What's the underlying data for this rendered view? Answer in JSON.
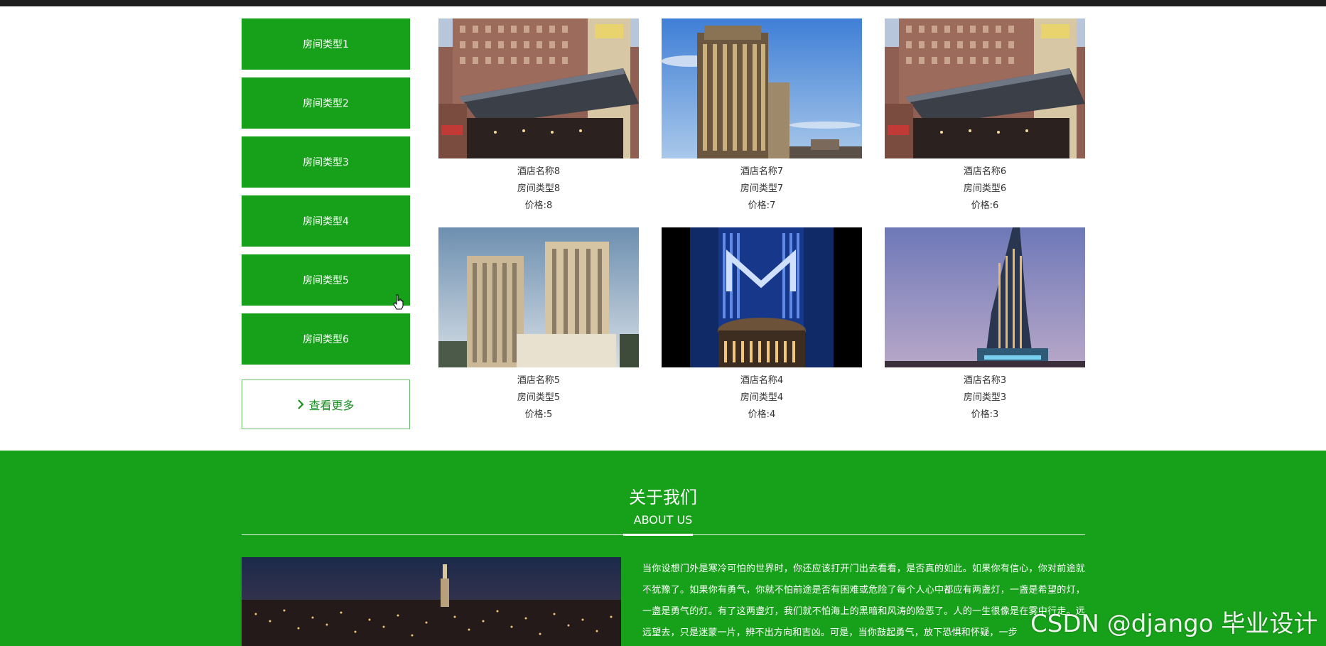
{
  "sidebar": {
    "items": [
      {
        "label": "房间类型1"
      },
      {
        "label": "房间类型2"
      },
      {
        "label": "房间类型3"
      },
      {
        "label": "房间类型4"
      },
      {
        "label": "房间类型5"
      },
      {
        "label": "房间类型6"
      }
    ],
    "more_label": "查看更多",
    "more_icon": "chevron-right-icon"
  },
  "hotels": [
    {
      "name": "酒店名称8",
      "room_type": "房间类型8",
      "price": "价格:8",
      "image": "hotel-entrance-canopy"
    },
    {
      "name": "酒店名称7",
      "room_type": "房间类型7",
      "price": "价格:7",
      "image": "tall-tower-blue-sky"
    },
    {
      "name": "酒店名称6",
      "room_type": "房间类型6",
      "price": "价格:6",
      "image": "hotel-entrance-canopy"
    },
    {
      "name": "酒店名称5",
      "room_type": "房间类型5",
      "price": "价格:5",
      "image": "twin-beige-towers"
    },
    {
      "name": "酒店名称4",
      "room_type": "房间类型4",
      "price": "价格:4",
      "image": "night-tower-m-logo"
    },
    {
      "name": "酒店名称3",
      "room_type": "房间类型3",
      "price": "价格:3",
      "image": "twisted-tower-dusk"
    }
  ],
  "about": {
    "title": "关于我们",
    "subtitle": "ABOUT US",
    "image": "city-skyline-night",
    "text": "当你设想门外是寒冷可怕的世界时，你还应该打开门出去看看，是否真的如此。如果你有信心，你对前途就不犹豫了。如果你有勇气，你就不怕前途是否有困难或危险了每个人心中都应有两盏灯，一盏是希望的灯，一盏是勇气的灯。有了这两盏灯，我们就不怕海上的黑暗和风涛的险恶了。人的一生很像是在雾中行走。远远望去，只是迷蒙一片，辨不出方向和吉凶。可是，当你鼓起勇气，放下恐惧和怀疑，一步"
  },
  "watermark": "CSDN @django 毕业设计",
  "colors": {
    "accent": "#17a01a",
    "top_bar": "#1e1e1e",
    "text": "#333333"
  }
}
